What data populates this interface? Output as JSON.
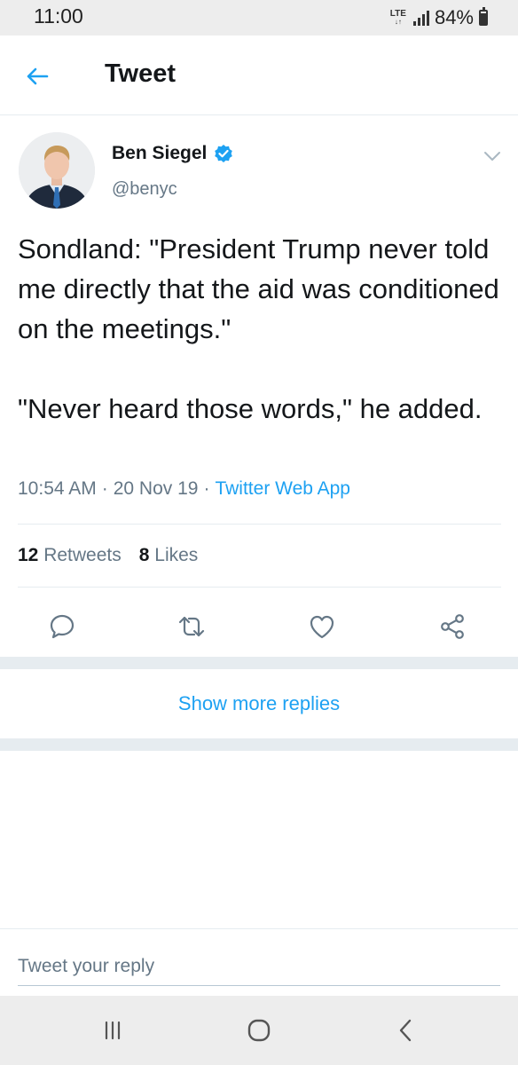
{
  "status_bar": {
    "time": "11:00",
    "network": "LTE",
    "battery": "84%"
  },
  "header": {
    "title": "Tweet",
    "back_icon": "arrow-left-icon"
  },
  "tweet": {
    "author_name": "Ben Siegel",
    "verified": true,
    "handle": "@benyc",
    "text": "Sondland: \"President Trump never told me directly that the aid was conditioned on the meetings.\"\n\n\"Never heard those words,\" he added.",
    "time": "10:54 AM",
    "date": "20 Nov 19",
    "source": "Twitter Web App",
    "retweets_count": "12",
    "retweets_label": "Retweets",
    "likes_count": "8",
    "likes_label": "Likes"
  },
  "actions": [
    "reply-icon",
    "retweet-icon",
    "like-icon",
    "share-icon"
  ],
  "show_more_replies": "Show more replies",
  "reply_box": {
    "placeholder": "Tweet your reply"
  },
  "colors": {
    "accent": "#1da1f2",
    "secondary_text": "#657786",
    "divider": "#e6ecf0"
  }
}
